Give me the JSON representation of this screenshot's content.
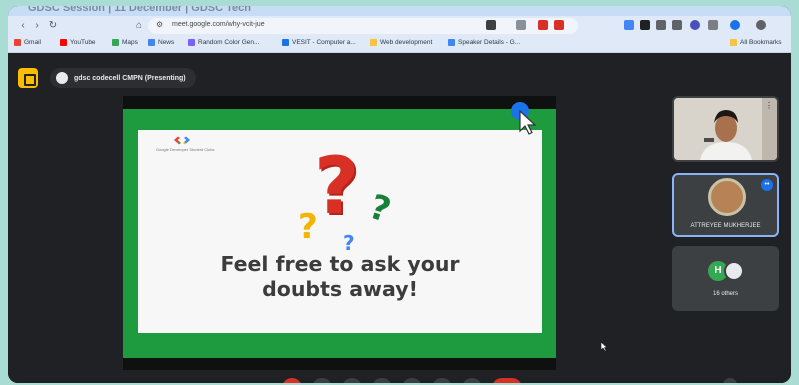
{
  "browser": {
    "tab_title": "GDSC Session | 11 December | GDSC Tech",
    "url": "meet.google.com/why-vcit-jue",
    "bookmarks": [
      {
        "label": "Gmail",
        "color": "#ea4335"
      },
      {
        "label": "YouTube",
        "color": "#ff0000"
      },
      {
        "label": "Maps",
        "color": "#34a853"
      },
      {
        "label": "News",
        "color": "#4285f4"
      },
      {
        "label": "Random Color Gen...",
        "color": "#7b61ff"
      },
      {
        "label": "VESIT - Computer a...",
        "color": "#1a73e8"
      },
      {
        "label": "Web development",
        "color": "#f6c343"
      },
      {
        "label": "Speaker Details - G...",
        "color": "#4285f4"
      }
    ],
    "all_bookmarks": "All Bookmarks"
  },
  "meet": {
    "presenting_label": "gdsc codecell CMPN (Presenting)",
    "slide": {
      "brand": "Google Developer Student Clubs",
      "caption_line1": "Feel free to ask your",
      "caption_line2": "doubts away!"
    },
    "participants": {
      "named": "ATTREYEE MUKHERJEE",
      "others_count": "16 others",
      "others_initial": "H"
    }
  },
  "colors": {
    "accent_green": "#1e9b3e",
    "meet_bg": "#202124",
    "border_teal": "#a9dcd3"
  }
}
